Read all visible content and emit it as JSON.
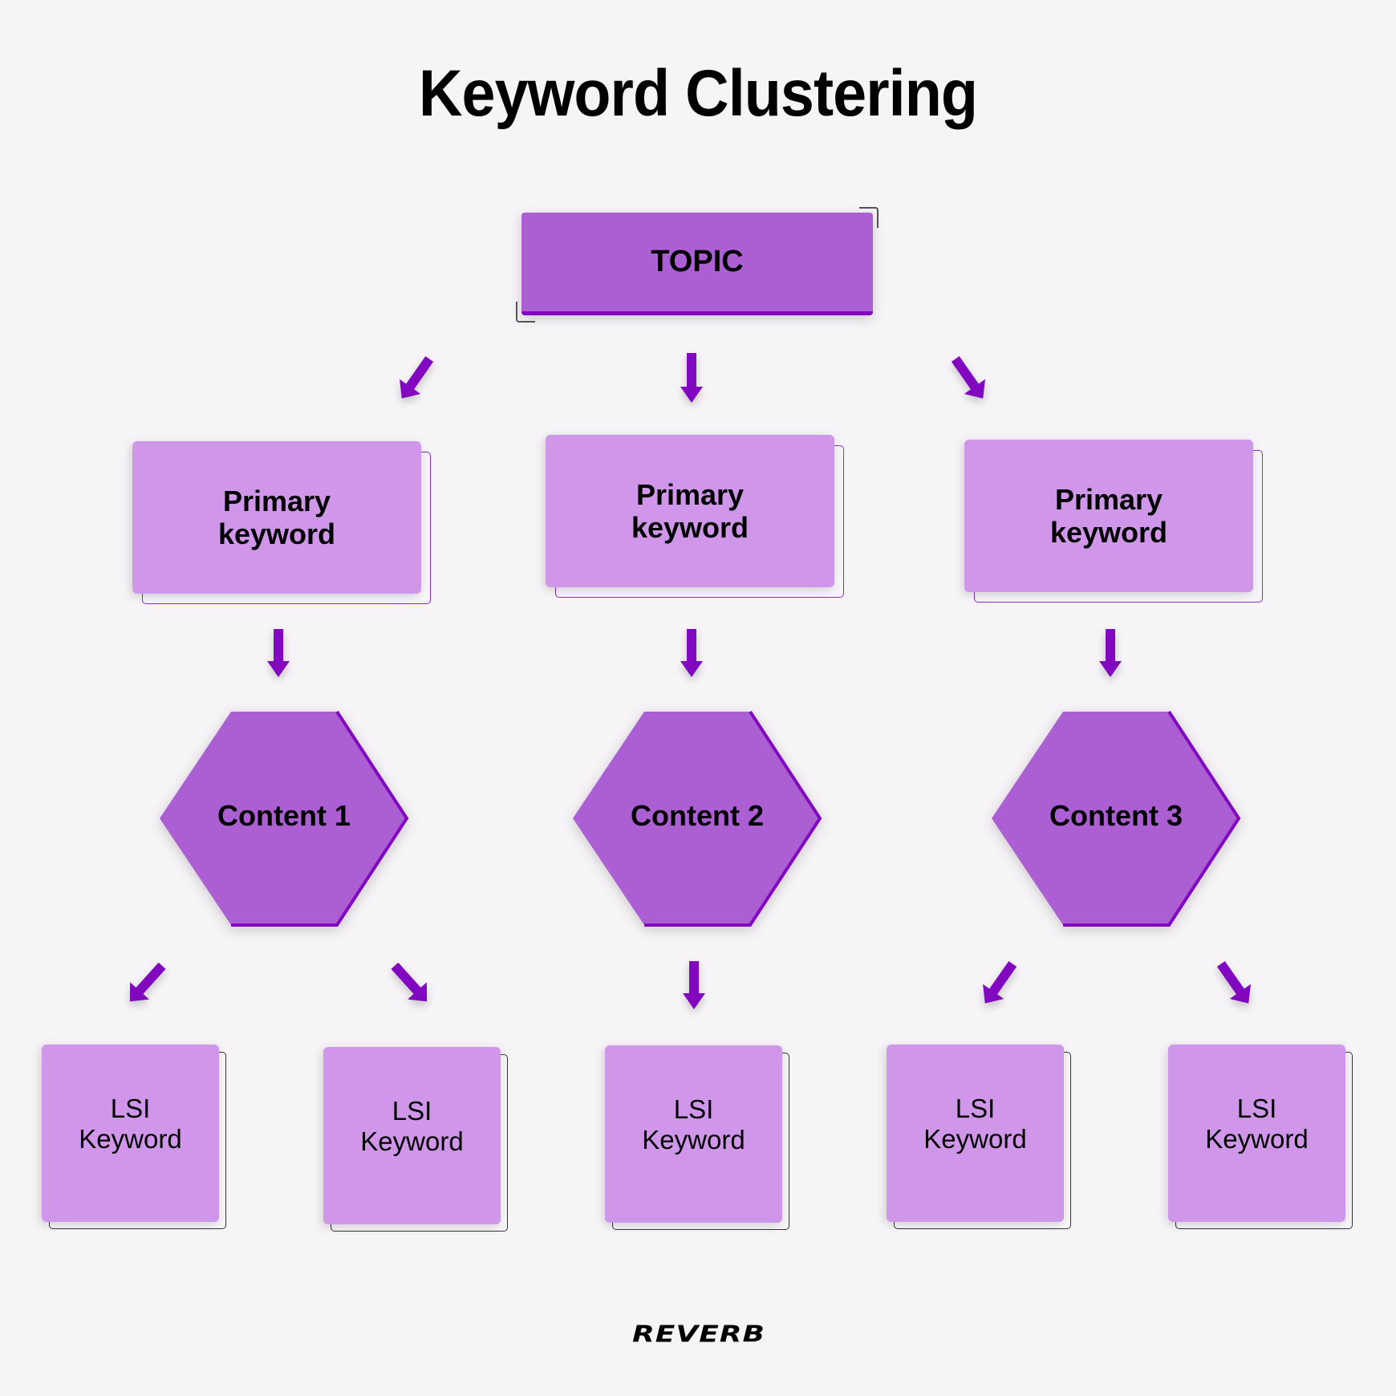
{
  "title": "Keyword Clustering",
  "colors": {
    "background": "#f6f4f6",
    "topic_fill": "#ac5fd3",
    "accent": "#8208bf",
    "card_fill": "#d096e9",
    "text": "#000000"
  },
  "topic": {
    "label": "TOPIC"
  },
  "primary_keywords": [
    {
      "label": "Primary\nkeyword"
    },
    {
      "label": "Primary\nkeyword"
    },
    {
      "label": "Primary\nkeyword"
    }
  ],
  "contents": [
    {
      "label": "Content 1"
    },
    {
      "label": "Content 2"
    },
    {
      "label": "Content 3"
    }
  ],
  "lsi_keywords": [
    {
      "label": "LSI\nKeyword",
      "parent": "Content 1"
    },
    {
      "label": "LSI\nKeyword",
      "parent": "Content 1"
    },
    {
      "label": "LSI\nKeyword",
      "parent": "Content 2"
    },
    {
      "label": "LSI\nKeyword",
      "parent": "Content 3"
    },
    {
      "label": "LSI\nKeyword",
      "parent": "Content 3"
    }
  ],
  "connections": [
    {
      "from": "TOPIC",
      "to": "Primary keyword 1",
      "direction": "down-left"
    },
    {
      "from": "TOPIC",
      "to": "Primary keyword 2",
      "direction": "down"
    },
    {
      "from": "TOPIC",
      "to": "Primary keyword 3",
      "direction": "down-right"
    },
    {
      "from": "Primary keyword 1",
      "to": "Content 1",
      "direction": "down"
    },
    {
      "from": "Primary keyword 2",
      "to": "Content 2",
      "direction": "down"
    },
    {
      "from": "Primary keyword 3",
      "to": "Content 3",
      "direction": "down"
    },
    {
      "from": "Content 1",
      "to": "LSI Keyword 1",
      "direction": "down-left"
    },
    {
      "from": "Content 1",
      "to": "LSI Keyword 2",
      "direction": "down-right"
    },
    {
      "from": "Content 2",
      "to": "LSI Keyword 3",
      "direction": "down"
    },
    {
      "from": "Content 3",
      "to": "LSI Keyword 4",
      "direction": "down-left"
    },
    {
      "from": "Content 3",
      "to": "LSI Keyword 5",
      "direction": "down-right"
    }
  ],
  "logo": {
    "text": "REVERB"
  }
}
